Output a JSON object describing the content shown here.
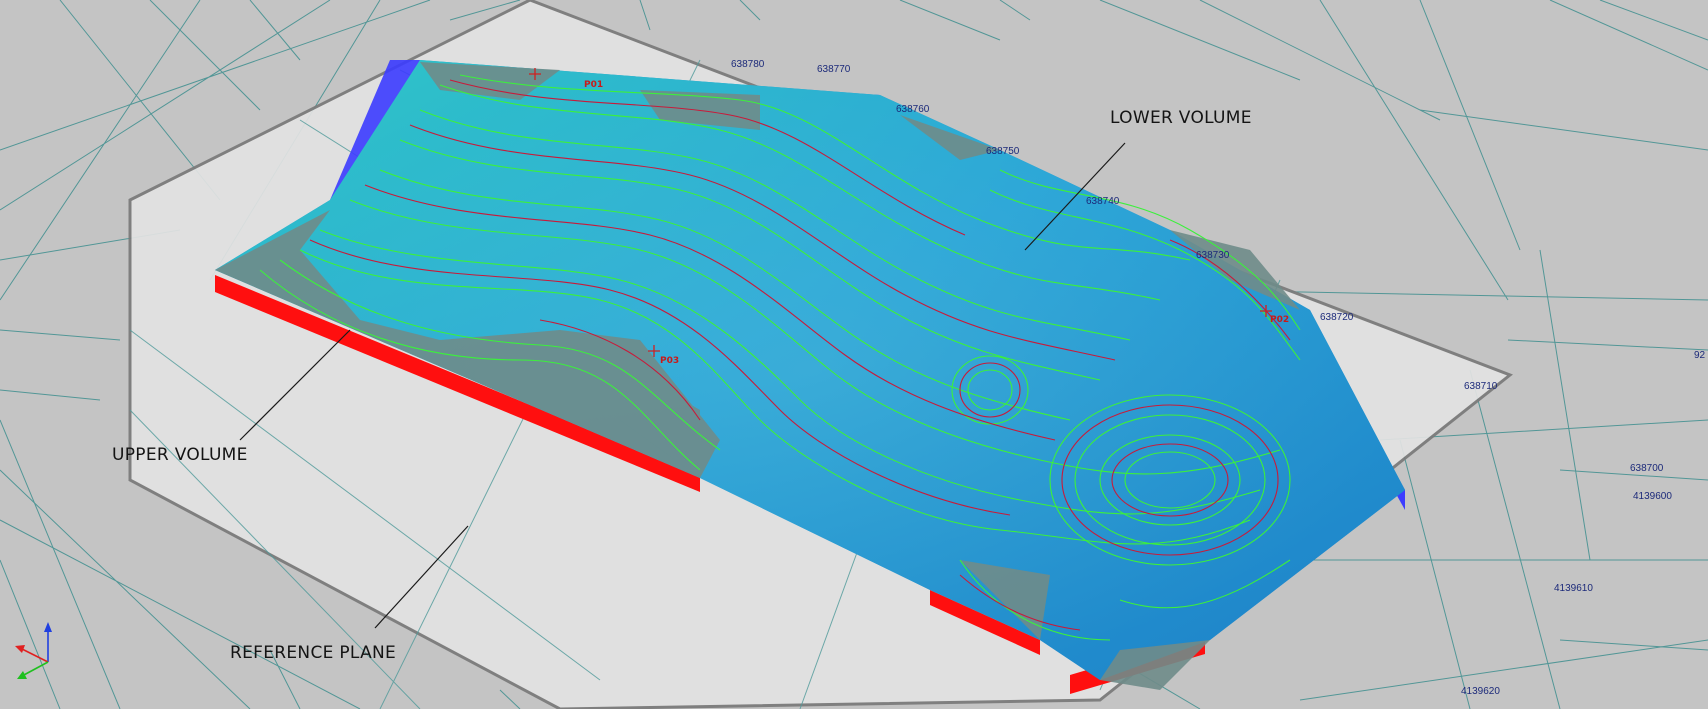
{
  "viewer": {
    "annotations": {
      "lower_volume": "LOWER VOLUME",
      "upper_volume": "UPPER VOLUME",
      "reference_plane": "REFERENCE PLANE"
    },
    "easting_ticks": [
      "638780",
      "638770",
      "638760",
      "638750",
      "638740",
      "638730",
      "638720",
      "638710",
      "638700"
    ],
    "northing_ticks": [
      "4139600",
      "4139610",
      "4139620"
    ],
    "edge_label_partial": "92",
    "points": [
      {
        "label": "P01"
      },
      {
        "label": "P02"
      },
      {
        "label": "P03"
      }
    ],
    "colors": {
      "background": "#c4c4c4",
      "grid": "#3f8f8f",
      "reference_plane": "#e3e3e3",
      "surface_low": "#1f8fd0",
      "surface_high": "#2fd8c0",
      "upper_volume_side": "#ff0f0f",
      "lower_volume_side": "#3c3cff",
      "contour_major": "#c81a3a",
      "contour_minor": "#3cf03c",
      "axis_x": "#e02020",
      "axis_y": "#20c020",
      "axis_z": "#2040e0"
    }
  }
}
